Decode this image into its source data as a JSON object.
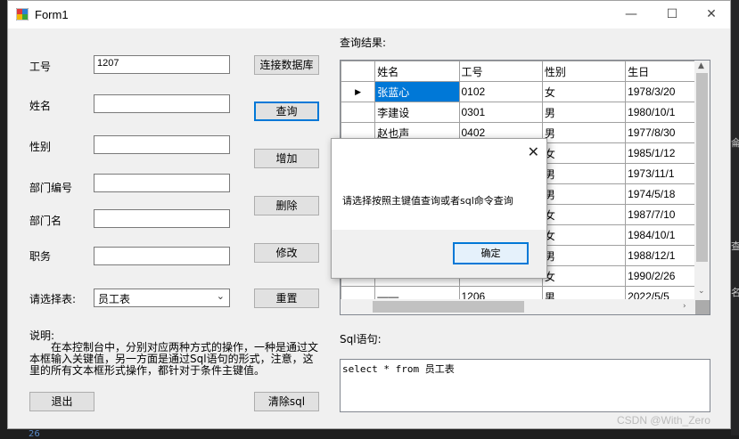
{
  "window": {
    "title": "Form1",
    "minimize": "—",
    "maximize": "☐",
    "close": "✕"
  },
  "labels": {
    "id": "工号",
    "name": "姓名",
    "gender": "性别",
    "dept_no": "部门编号",
    "dept_name": "部门名",
    "position": "职务",
    "select_table": "请选择表:",
    "query_result": "查询结果:",
    "sql_stmt": "Sql语句:"
  },
  "inputs": {
    "id": "1207",
    "name": "",
    "gender": "",
    "dept_no": "",
    "dept_name": "",
    "position": ""
  },
  "combo": {
    "selected": "员工表"
  },
  "buttons": {
    "connect": "连接数据库",
    "query": "查询",
    "add": "增加",
    "delete": "删除",
    "modify": "修改",
    "reset": "重置",
    "exit": "退出",
    "clear_sql": "清除sql"
  },
  "description": {
    "heading": "说明:",
    "text": "在本控制台中，分别对应两种方式的操作，一种是通过文本框输入关键值，另一方面是通过Sql语句的形式，注意，这里的所有文本框形式操作，都针对于条件主键值。"
  },
  "grid": {
    "columns": [
      "姓名",
      "工号",
      "性别",
      "生日"
    ],
    "rows": [
      {
        "marker": "▶",
        "cells": [
          "张蓝心",
          "0102",
          "女",
          "1978/3/20"
        ]
      },
      {
        "marker": "",
        "cells": [
          "李建设",
          "0301",
          "男",
          "1980/10/1"
        ]
      },
      {
        "marker": "",
        "cells": [
          "赵也声",
          "0402",
          "男",
          "1977/8/30"
        ]
      },
      {
        "marker": "",
        "cells": [
          "",
          "",
          "女",
          "1985/1/12"
        ]
      },
      {
        "marker": "",
        "cells": [
          "",
          "",
          "男",
          "1973/11/1"
        ]
      },
      {
        "marker": "",
        "cells": [
          "",
          "",
          "男",
          "1974/5/18"
        ]
      },
      {
        "marker": "",
        "cells": [
          "",
          "",
          "女",
          "1987/7/10"
        ]
      },
      {
        "marker": "",
        "cells": [
          "",
          "",
          "女",
          "1984/10/1"
        ]
      },
      {
        "marker": "",
        "cells": [
          "",
          "",
          "男",
          "1988/12/1"
        ]
      },
      {
        "marker": "",
        "cells": [
          "",
          "",
          "女",
          "1990/2/26"
        ]
      },
      {
        "marker": "",
        "cells": [
          "——",
          "1206",
          "男",
          "2022/5/5"
        ]
      }
    ]
  },
  "sql": {
    "text": "select * from 员工表"
  },
  "dialog": {
    "message": "请选择按照主键值查询或者sql命令查询",
    "ok": "确定",
    "close": "✕"
  },
  "watermark": "CSDN @With_Zero",
  "side_chars": [
    "侖",
    "查",
    "名"
  ],
  "bottom_num": "26"
}
